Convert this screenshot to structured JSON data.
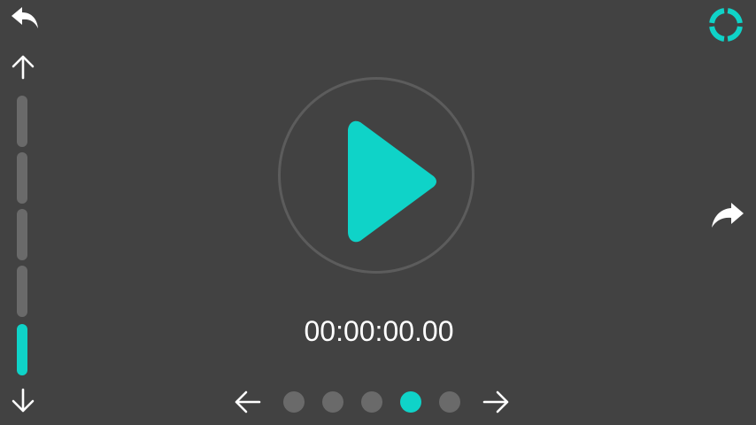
{
  "timer": {
    "display": "00:00:00.00"
  },
  "colors": {
    "accent": "#0fd3c8",
    "background": "#424242",
    "inactive": "#6a6a6a"
  },
  "icons": {
    "back": "undo-arrow-icon",
    "loading": "ring-icon",
    "forward": "forward-arrow-icon",
    "up": "arrow-up-icon",
    "down": "arrow-down-icon",
    "prev": "arrow-left-icon",
    "next": "arrow-right-icon",
    "play": "play-icon"
  },
  "level_meter": {
    "segments": 5,
    "active_segment": 5
  },
  "pager": {
    "pages": 5,
    "current_page": 4
  }
}
